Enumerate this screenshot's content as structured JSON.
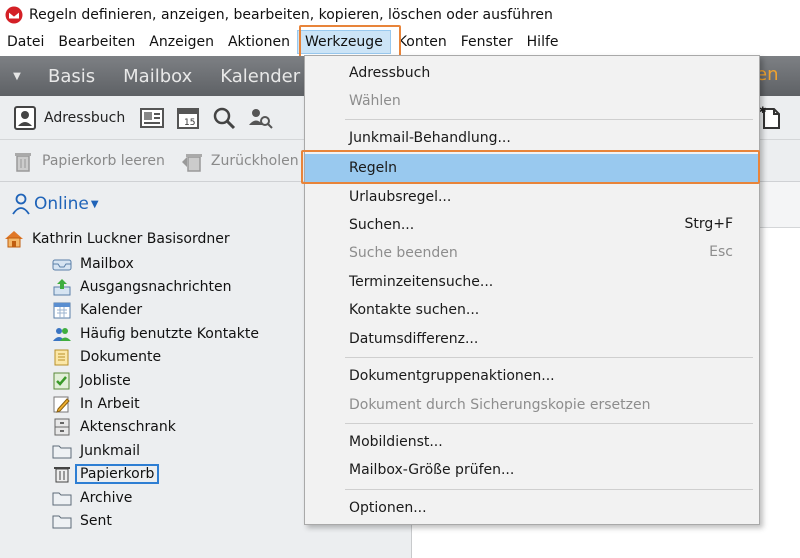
{
  "window": {
    "title": "Regeln definieren, anzeigen, bearbeiten, kopieren, löschen oder ausführen"
  },
  "menubar": {
    "items": [
      "Datei",
      "Bearbeiten",
      "Anzeigen",
      "Aktionen",
      "Werkzeuge",
      "Konten",
      "Fenster",
      "Hilfe"
    ],
    "active": "Werkzeuge"
  },
  "nav": {
    "items": [
      "Basis",
      "Mailbox",
      "Kalender"
    ],
    "right_fragment": "en"
  },
  "toolbar1": {
    "adressbuch_label": "Adressbuch"
  },
  "toolbar2": {
    "papierkorb_leeren": "Papierkorb leeren",
    "zurueckholen": "Zurückholen"
  },
  "left": {
    "online_label": "Online",
    "root_label": "Kathrin Luckner Basisordner",
    "folders": [
      "Mailbox",
      "Ausgangsnachrichten",
      "Kalender",
      "Häufig benutzte Kontakte",
      "Dokumente",
      "Jobliste",
      "In Arbeit",
      "Aktenschrank",
      "Junkmail",
      "Papierkorb",
      "Archive",
      "Sent"
    ],
    "selected_folder": "Papierkorb"
  },
  "dropdown": {
    "items": [
      {
        "label": "Adressbuch",
        "shortcut": "",
        "disabled": false
      },
      {
        "label": "Wählen",
        "shortcut": "",
        "disabled": true
      },
      {
        "label": "Junkmail-Behandlung...",
        "shortcut": "",
        "disabled": false
      },
      {
        "label": "Regeln",
        "shortcut": "",
        "disabled": false,
        "selected": true
      },
      {
        "label": "Urlaubsregel...",
        "shortcut": "",
        "disabled": false
      },
      {
        "label": "Suchen...",
        "shortcut": "Strg+F",
        "disabled": false
      },
      {
        "label": "Suche beenden",
        "shortcut": "Esc",
        "disabled": true
      },
      {
        "label": "Terminzeitensuche...",
        "shortcut": "",
        "disabled": false
      },
      {
        "label": "Kontakte suchen...",
        "shortcut": "",
        "disabled": false
      },
      {
        "label": "Datumsdifferenz...",
        "shortcut": "",
        "disabled": false
      },
      {
        "label": "Dokumentgruppenaktionen...",
        "shortcut": "",
        "disabled": false
      },
      {
        "label": "Dokument durch Sicherungskopie ersetzen",
        "shortcut": "",
        "disabled": true
      },
      {
        "label": "Mobildienst...",
        "shortcut": "",
        "disabled": false
      },
      {
        "label": "Mailbox-Größe prüfen...",
        "shortcut": "",
        "disabled": false
      },
      {
        "label": "Optionen...",
        "shortcut": "",
        "disabled": false
      }
    ]
  },
  "colors": {
    "highlight_outline": "#e8843a",
    "menu_selection": "#99c9ef",
    "online_link": "#1f63b8"
  }
}
